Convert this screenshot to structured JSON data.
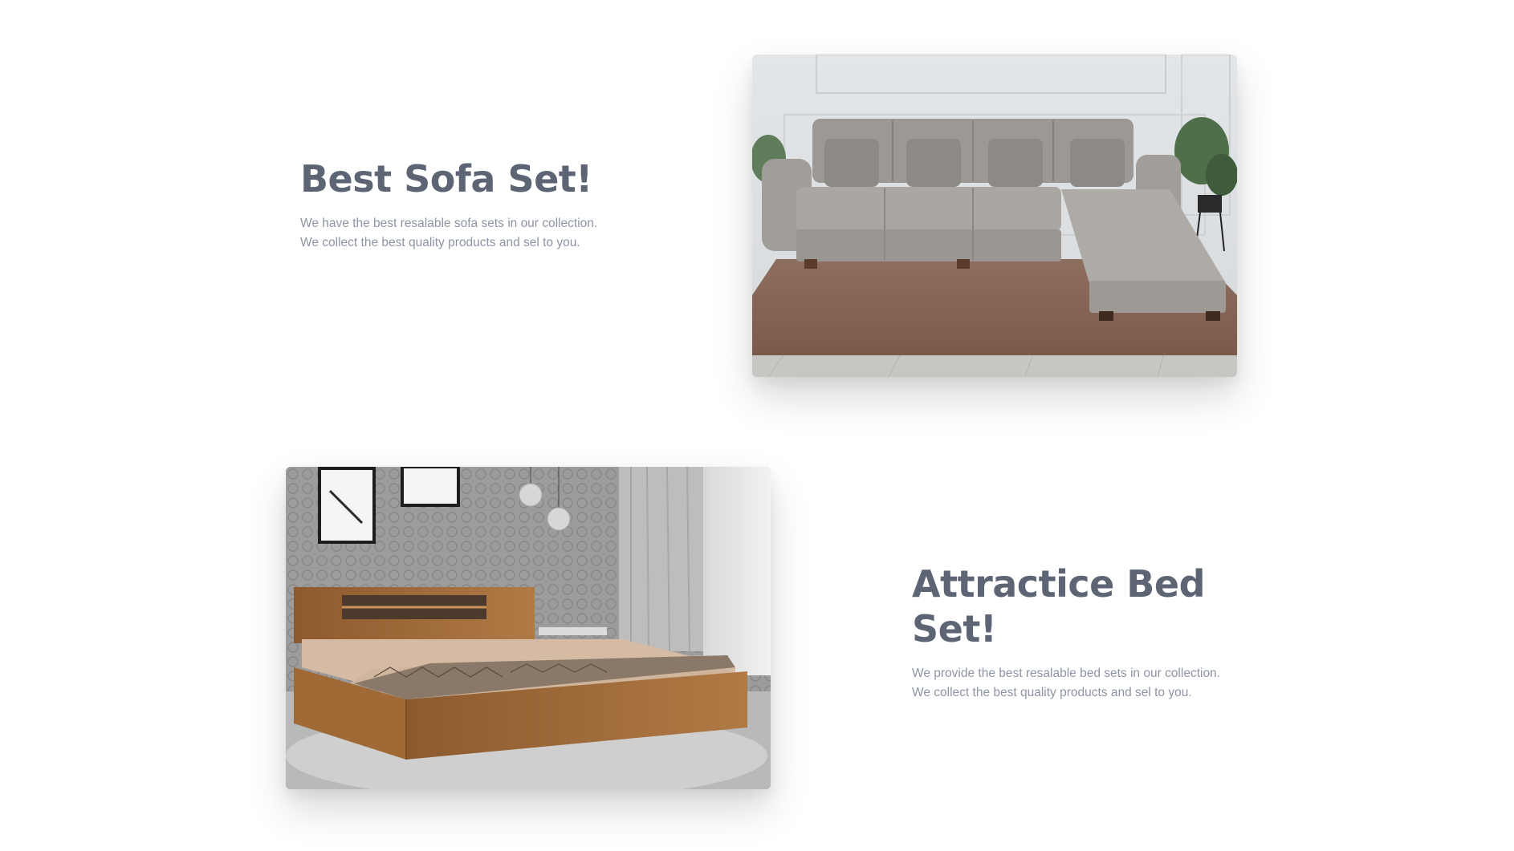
{
  "features": [
    {
      "title": "Best Sofa Set!",
      "description": "We have the best resalable sofa sets in our collection. We collect the best quality products and sel to you.",
      "image_name": "sofa-set-photo"
    },
    {
      "title": "Attractice Bed Set!",
      "description": "We provide the best resalable bed sets in our collection. We collect the best quality products and sel to you.",
      "image_name": "bed-set-photo"
    }
  ],
  "colors": {
    "title": "#5d6575",
    "description": "#8d94a3",
    "background": "#ffffff"
  }
}
